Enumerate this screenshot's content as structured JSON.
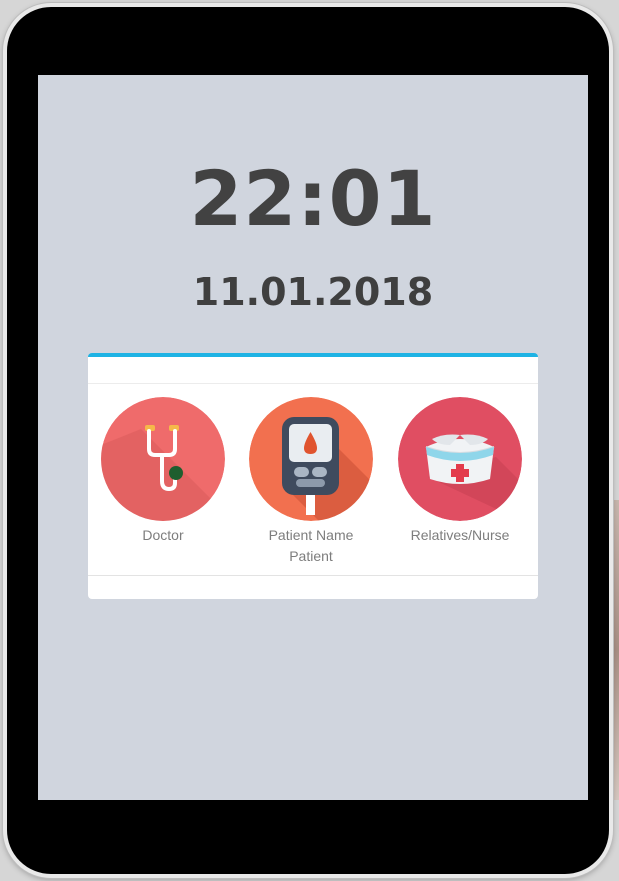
{
  "clock": {
    "time": "22:01",
    "date": "11.01.2018"
  },
  "roles": [
    {
      "label": "Doctor",
      "icon": "stethoscope-icon",
      "color": "#ef6b6b"
    },
    {
      "label": "Patient Name",
      "sublabel": "Patient",
      "icon": "glucose-meter-icon",
      "color": "#f2704f"
    },
    {
      "label": "Relatives/Nurse",
      "icon": "nurse-cap-icon",
      "color": "#e04e62"
    }
  ],
  "colors": {
    "screen_background": "#d0d5de",
    "card_accent": "#1eb3e4",
    "text_dark": "#424242",
    "text_muted": "#7d7d7d"
  }
}
